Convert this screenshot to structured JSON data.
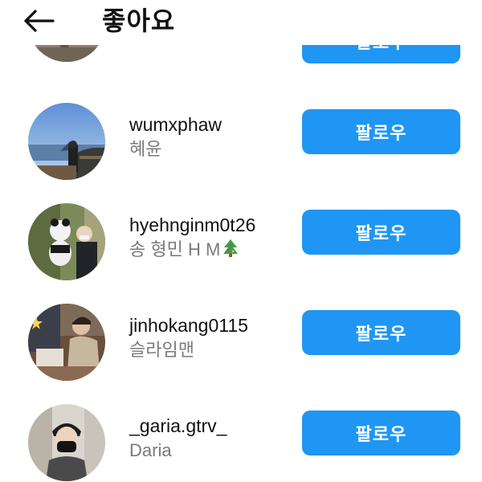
{
  "header": {
    "title": "좋아요",
    "back_icon": "arrow-left-icon"
  },
  "colors": {
    "accent": "#1f96f3",
    "username": "#111111",
    "fullname": "#7a7a7a",
    "background": "#ffffff"
  },
  "users": [
    {
      "username": "",
      "fullname": "",
      "button": "팔로우",
      "partial": true
    },
    {
      "username": "wumxphaw",
      "fullname": "혜윤",
      "button": "팔로우"
    },
    {
      "username": "hyehnginm0t26",
      "fullname": "송 형민 H M",
      "emoji": "christmas-tree-icon",
      "button": "팔로우"
    },
    {
      "username": "jinhokang0115",
      "fullname": "슬라임맨",
      "button": "팔로우"
    },
    {
      "username": "_garia.gtrv_",
      "fullname": "Daria",
      "button": "팔로우"
    }
  ]
}
